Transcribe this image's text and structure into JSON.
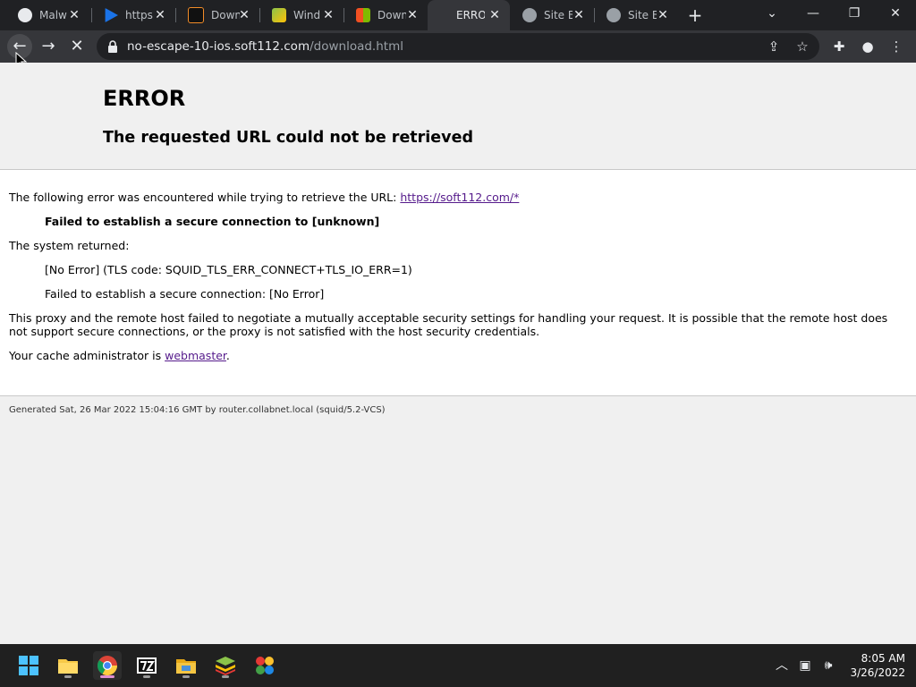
{
  "browser": {
    "tabs": [
      {
        "label": "Malw",
        "icon": "github-icon",
        "active": false
      },
      {
        "label": "https:",
        "icon": "play-triangle-icon",
        "active": false
      },
      {
        "label": "Down",
        "icon": "download-app-icon",
        "active": false
      },
      {
        "label": "Wind",
        "icon": "bluestacks-icon",
        "active": false
      },
      {
        "label": "Down",
        "icon": "microsoft-icon",
        "active": false
      },
      {
        "label": "ERRO",
        "icon": "none",
        "active": true
      },
      {
        "label": "Site B",
        "icon": "globe-icon",
        "active": false
      },
      {
        "label": "Site B",
        "icon": "globe-icon",
        "active": false
      }
    ],
    "address": {
      "domain": "no-escape-10-ios.soft112.com",
      "path": "/download.html"
    }
  },
  "error_page": {
    "title": "ERROR",
    "subtitle": "The requested URL could not be retrieved",
    "intro": "The following error was encountered while trying to retrieve the URL: ",
    "url_link": "https://soft112.com/*",
    "failure": "Failed to establish a secure connection to [unknown]",
    "system_returned": "The system returned:",
    "tls_code": "[No Error] (TLS code: SQUID_TLS_ERR_CONNECT+TLS_IO_ERR=1)",
    "secure_fail": "Failed to establish a secure connection: [No Error]",
    "explanation": "This proxy and the remote host failed to negotiate a mutually acceptable security settings for handling your request. It is possible that the remote host does not support secure connections, or the proxy is not satisfied with the host security credentials.",
    "admin_prefix": "Your cache administrator is ",
    "admin_link": "webmaster",
    "admin_suffix": ".",
    "footer": "Generated Sat, 26 Mar 2022 15:04:16 GMT by router.collabnet.local (squid/5.2-VCS)"
  },
  "taskbar": {
    "apps": [
      "windows-start-icon",
      "file-explorer-icon",
      "chrome-icon",
      "7zip-icon",
      "folder-icon",
      "bluestacks-icon",
      "multi-app-icon"
    ],
    "time": "8:05 AM",
    "date": "3/26/2022"
  },
  "colors": {
    "link": "#551a8b",
    "tab_bar": "#202124",
    "toolbar": "#35363a",
    "taskbar": "#202020"
  }
}
